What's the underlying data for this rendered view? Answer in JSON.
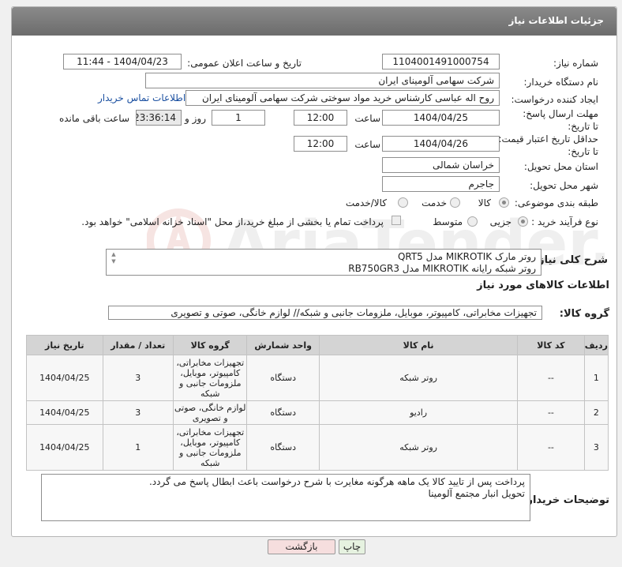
{
  "header": {
    "title": "جزئیات اطلاعات نیاز"
  },
  "need_number": {
    "label": "شماره نیاز:",
    "value": "1104001491000754"
  },
  "announce": {
    "label": "تاریخ و ساعت اعلان عمومی:",
    "value": "1404/04/23 - 11:44"
  },
  "buyer_org": {
    "label": "نام دستگاه خریدار:",
    "value": "شرکت سهامی آلومینای ایران"
  },
  "requester": {
    "label": "ایجاد کننده درخواست:",
    "value": "روح اله عباسی کارشناس خرید مواد سوختی شرکت سهامی آلومینای ایران",
    "contact_link": "اطلاعات تماس خریدار"
  },
  "deadline": {
    "label": "مهلت ارسال پاسخ: تا تاریخ:",
    "date": "1404/04/25",
    "time_label": "ساعت",
    "time": "12:00",
    "days": "1",
    "days_label": "روز و",
    "remaining": "23:36:14",
    "remaining_label": "ساعت باقی مانده"
  },
  "price_validity": {
    "label": "حداقل تاریخ اعتبار قیمت: تا تاریخ:",
    "date": "1404/04/26",
    "time_label": "ساعت",
    "time": "12:00"
  },
  "province": {
    "label": "استان محل تحویل:",
    "value": "خراسان شمالی"
  },
  "city": {
    "label": "شهر محل تحویل:",
    "value": "جاجرم"
  },
  "category": {
    "label": "طبقه بندی موضوعی:",
    "options": [
      "کالا",
      "خدمت",
      "کالا/خدمت"
    ],
    "selected": "کالا"
  },
  "process": {
    "label": "نوع فرآیند خرید :",
    "options": [
      "جزیی",
      "متوسط"
    ],
    "selected": "جزیی",
    "note": "پرداخت تمام یا بخشی از مبلغ خرید،از محل \"اسناد خزانه اسلامی\" خواهد بود."
  },
  "description": {
    "label": "شرح کلی نیاز:",
    "lines": [
      "روتر مارک MIKROTIK مدل QRT5",
      "روتر شبکه رایانه  MIKROTIK مدل RB750GR3"
    ]
  },
  "goods_info": {
    "title": "اطلاعات کالاهای مورد نیاز"
  },
  "goods_group": {
    "label": "گروه کالا:",
    "value": "تجهیزات مخابراتی، کامپیوتر، موبایل، ملزومات جانبی و شبکه// لوازم خانگی، صوتی و تصویری"
  },
  "table": {
    "headers": [
      "ردیف",
      "کد کالا",
      "نام کالا",
      "واحد شمارش",
      "گروه کالا",
      "تعداد / مقدار",
      "تاریخ نیاز"
    ],
    "rows": [
      {
        "row": "1",
        "code": "--",
        "name": "روتر شبکه",
        "unit": "دستگاه",
        "group": "تجهیزات مخابراتی، کامپیوتر، موبایل، ملزومات جانبی و شبکه",
        "qty": "3",
        "date": "1404/04/25"
      },
      {
        "row": "2",
        "code": "--",
        "name": "رادیو",
        "unit": "دستگاه",
        "group": "لوازم خانگی، صوتی و تصویری",
        "qty": "3",
        "date": "1404/04/25"
      },
      {
        "row": "3",
        "code": "--",
        "name": "روتر شبکه",
        "unit": "دستگاه",
        "group": "تجهیزات مخابراتی، کامپیوتر، موبایل، ملزومات جانبی و شبکه",
        "qty": "1",
        "date": "1404/04/25"
      }
    ]
  },
  "buyer_notes": {
    "label": "توضیحات خریدار:",
    "lines": [
      "پرداخت پس از تایید کالا یک ماهه هرگونه مغایرت با شرح درخواست باعث ابطال پاسخ می گردد.",
      "تحویل انبار مجتمع آلومینا"
    ]
  },
  "buttons": {
    "print": "چاپ",
    "back": "بازگشت"
  }
}
